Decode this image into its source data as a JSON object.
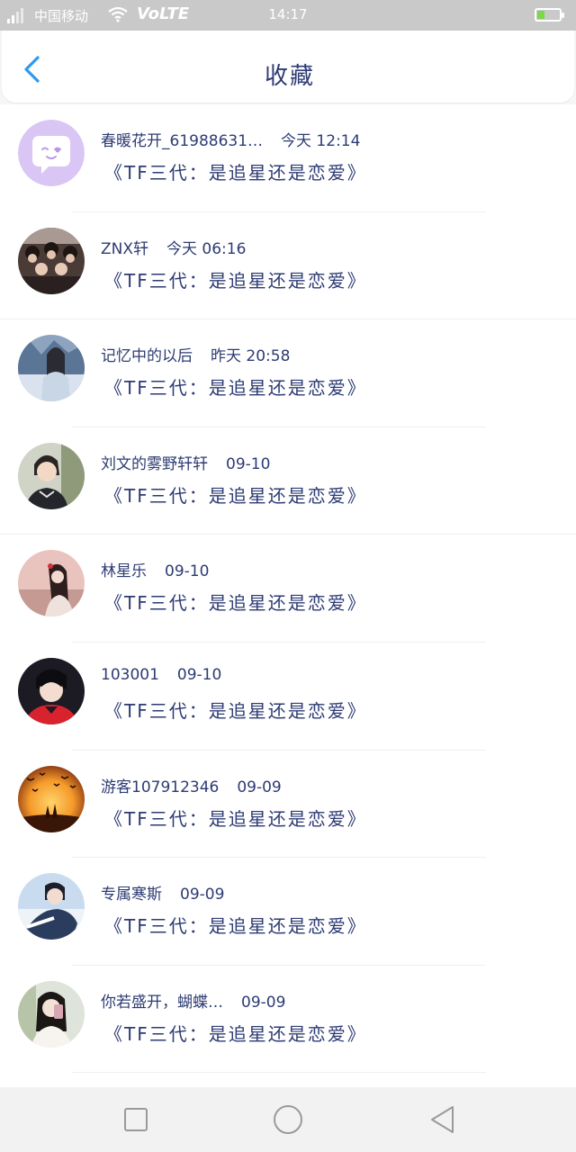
{
  "status_bar": {
    "carrier": "中国移动",
    "network": "VoLTE",
    "time": "14:17"
  },
  "header": {
    "title": "收藏",
    "back_icon": "chevron-left-icon"
  },
  "items": [
    {
      "user": "春暖花开_61988631…",
      "time": "今天 12:14",
      "content": "《TF三代：是追星还是恋爱》",
      "avatar": "robot-face"
    },
    {
      "user": "ZNX轩",
      "time": "今天 06:16",
      "content": "《TF三代：是追星还是恋爱》",
      "avatar": "group-photo"
    },
    {
      "user": "记忆中的以后",
      "time": "昨天 20:58",
      "content": "《TF三代：是追星还是恋爱》",
      "avatar": "winter-girl"
    },
    {
      "user": "刘文的雾野轩轩",
      "time": "09-10",
      "content": "《TF三代：是追星还是恋爱》",
      "avatar": "boy-portrait"
    },
    {
      "user": "林星乐",
      "time": "09-10",
      "content": "《TF三代：是追星还是恋爱》",
      "avatar": "pink-girl"
    },
    {
      "user": "103001",
      "time": "09-10",
      "content": "《TF三代：是追星还是恋爱》",
      "avatar": "boy-red-shirt"
    },
    {
      "user": "游客107912346",
      "time": "09-09",
      "content": "《TF三代：是追星还是恋爱》",
      "avatar": "sunset-birds"
    },
    {
      "user": "专属寒斯",
      "time": "09-09",
      "content": "《TF三代：是追星还是恋爱》",
      "avatar": "snow-boy"
    },
    {
      "user": "你若盛开，蝴蝶…",
      "time": "09-09",
      "content": "《TF三代：是追星还是恋爱》",
      "avatar": "girl-selfie"
    }
  ],
  "nav_bar": {
    "recent_icon": "square-icon",
    "home_icon": "circle-icon",
    "back_icon": "triangle-back-icon"
  },
  "colors": {
    "text": "#2d3b73",
    "accent": "#2b9af3",
    "status_bar": "#c9c9c9",
    "nav_bar": "#f2f2f2"
  }
}
